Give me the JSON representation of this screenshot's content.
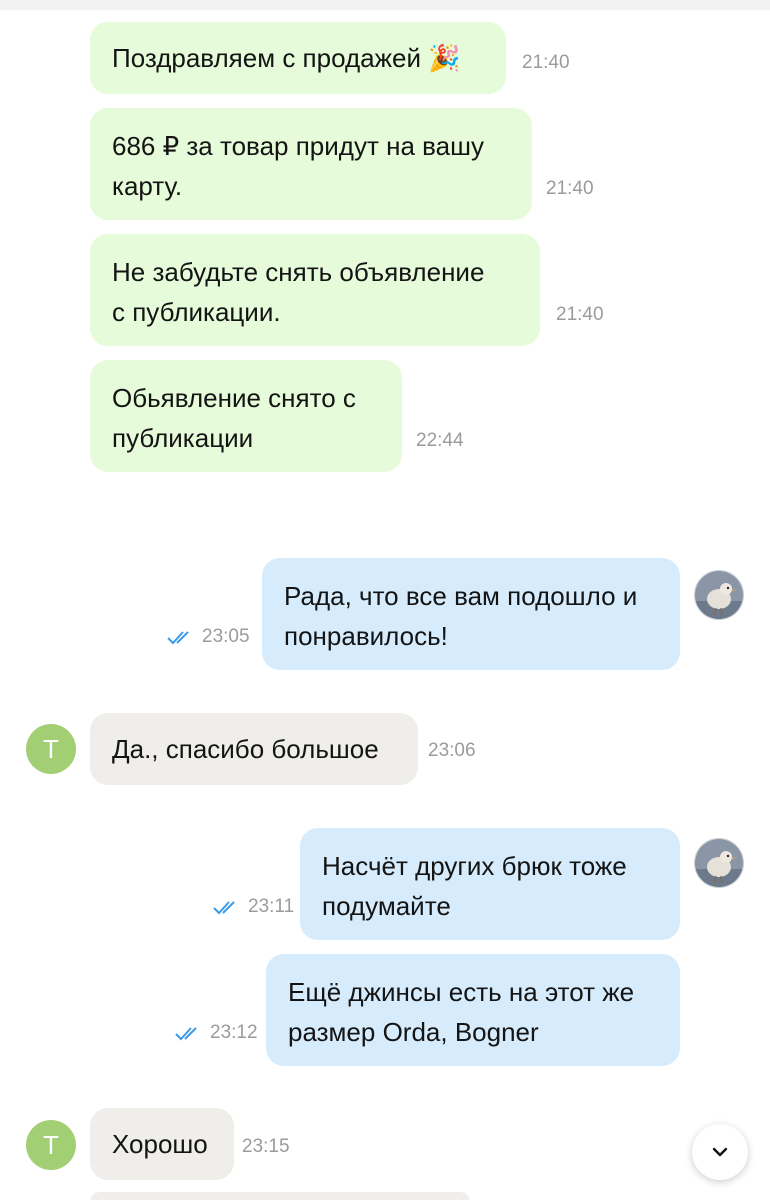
{
  "messages": [
    {
      "text": "Поздравляем с продажей",
      "emoji": "🎉",
      "time": "21:40"
    },
    {
      "text": "686 ₽ за товар придут на вашу",
      "text2": "карту.",
      "time": "21:40"
    },
    {
      "text": "Не забудьте снять объявление",
      "text2": "с публикации.",
      "time": "21:40"
    },
    {
      "text": "Обьявление снято с",
      "text2": "публикации",
      "time": "22:44"
    },
    {
      "text": "Рада, что все вам подошло и",
      "text2": "понравилось!",
      "time": "23:05"
    },
    {
      "text": "Да., спасибо большое",
      "time": "23:06"
    },
    {
      "text": "Насчёт других брюк тоже",
      "text2": "подумайте",
      "time": "23:11"
    },
    {
      "text": "Ещё джинсы есть на этот же",
      "text2": "размер Orda, Bogner",
      "time": "23:12"
    },
    {
      "text": "Хорошо",
      "time": "23:15"
    }
  ],
  "contact": {
    "initial": "T",
    "avatar_color": "#a3cf74"
  },
  "colors": {
    "system_bubble": "#e6fbd9",
    "outgoing_bubble": "#d6ecfc",
    "incoming_bubble": "#efeeeb",
    "read_ticks": "#3d9be9"
  },
  "icons": {
    "read_receipt": "double-check-icon",
    "scroll_down": "chevron-down-icon",
    "own_avatar": "bird-photo-avatar"
  }
}
